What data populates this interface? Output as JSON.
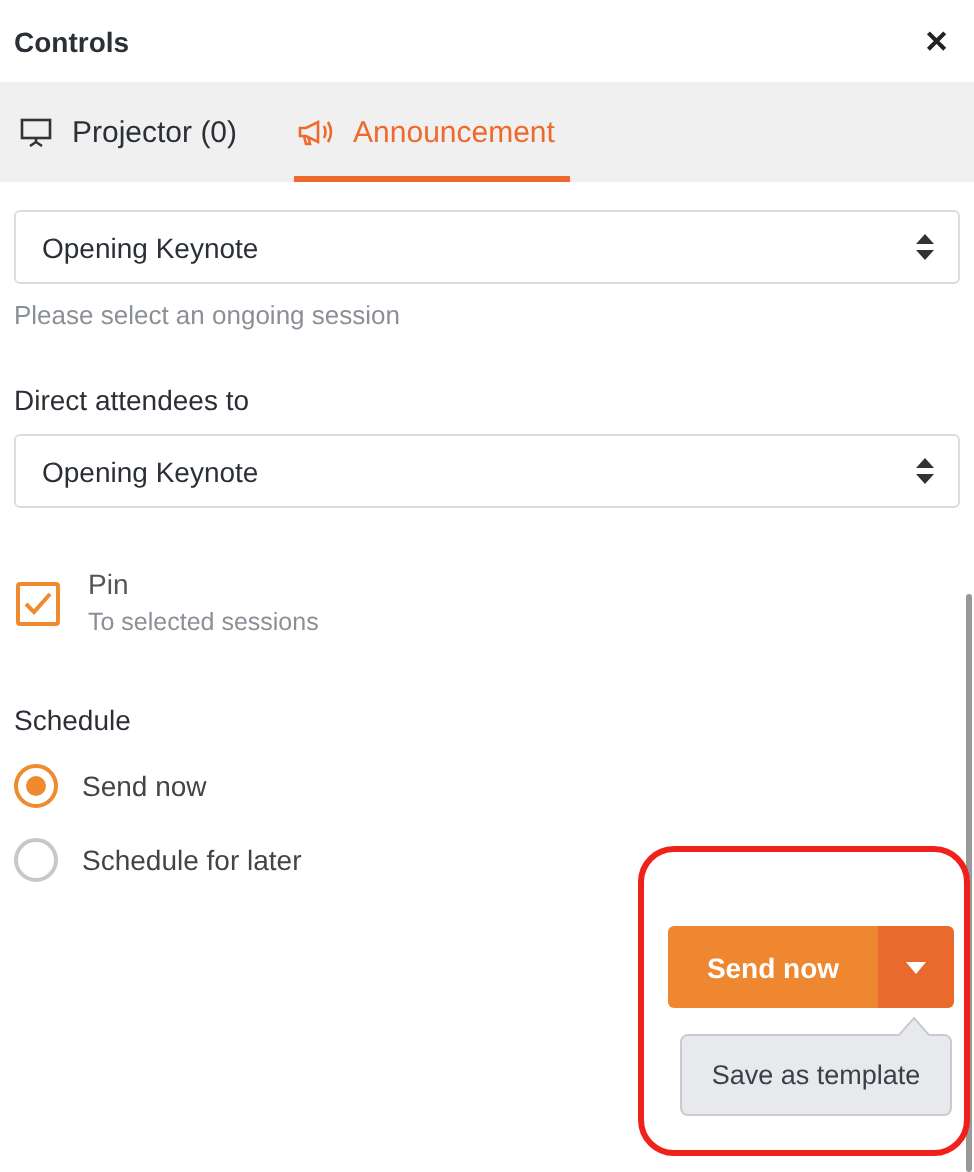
{
  "window": {
    "title": "Controls",
    "close": "✕"
  },
  "tabs": [
    {
      "label": "Projector (0)",
      "selected": false
    },
    {
      "label": "Announcement",
      "selected": true
    }
  ],
  "send_to": {
    "value": "Opening Keynote",
    "hint": "Please select an ongoing session"
  },
  "direct_to": {
    "label": "Direct attendees to",
    "value": "Opening Keynote"
  },
  "pin": {
    "label": "Pin",
    "sublabel": "To selected sessions",
    "checked": true
  },
  "schedule": {
    "label": "Schedule",
    "options": [
      {
        "label": "Send now",
        "selected": true
      },
      {
        "label": "Schedule for later",
        "selected": false
      }
    ]
  },
  "send_button": {
    "label": "Send now"
  },
  "tooltip": {
    "text": "Save as template"
  }
}
